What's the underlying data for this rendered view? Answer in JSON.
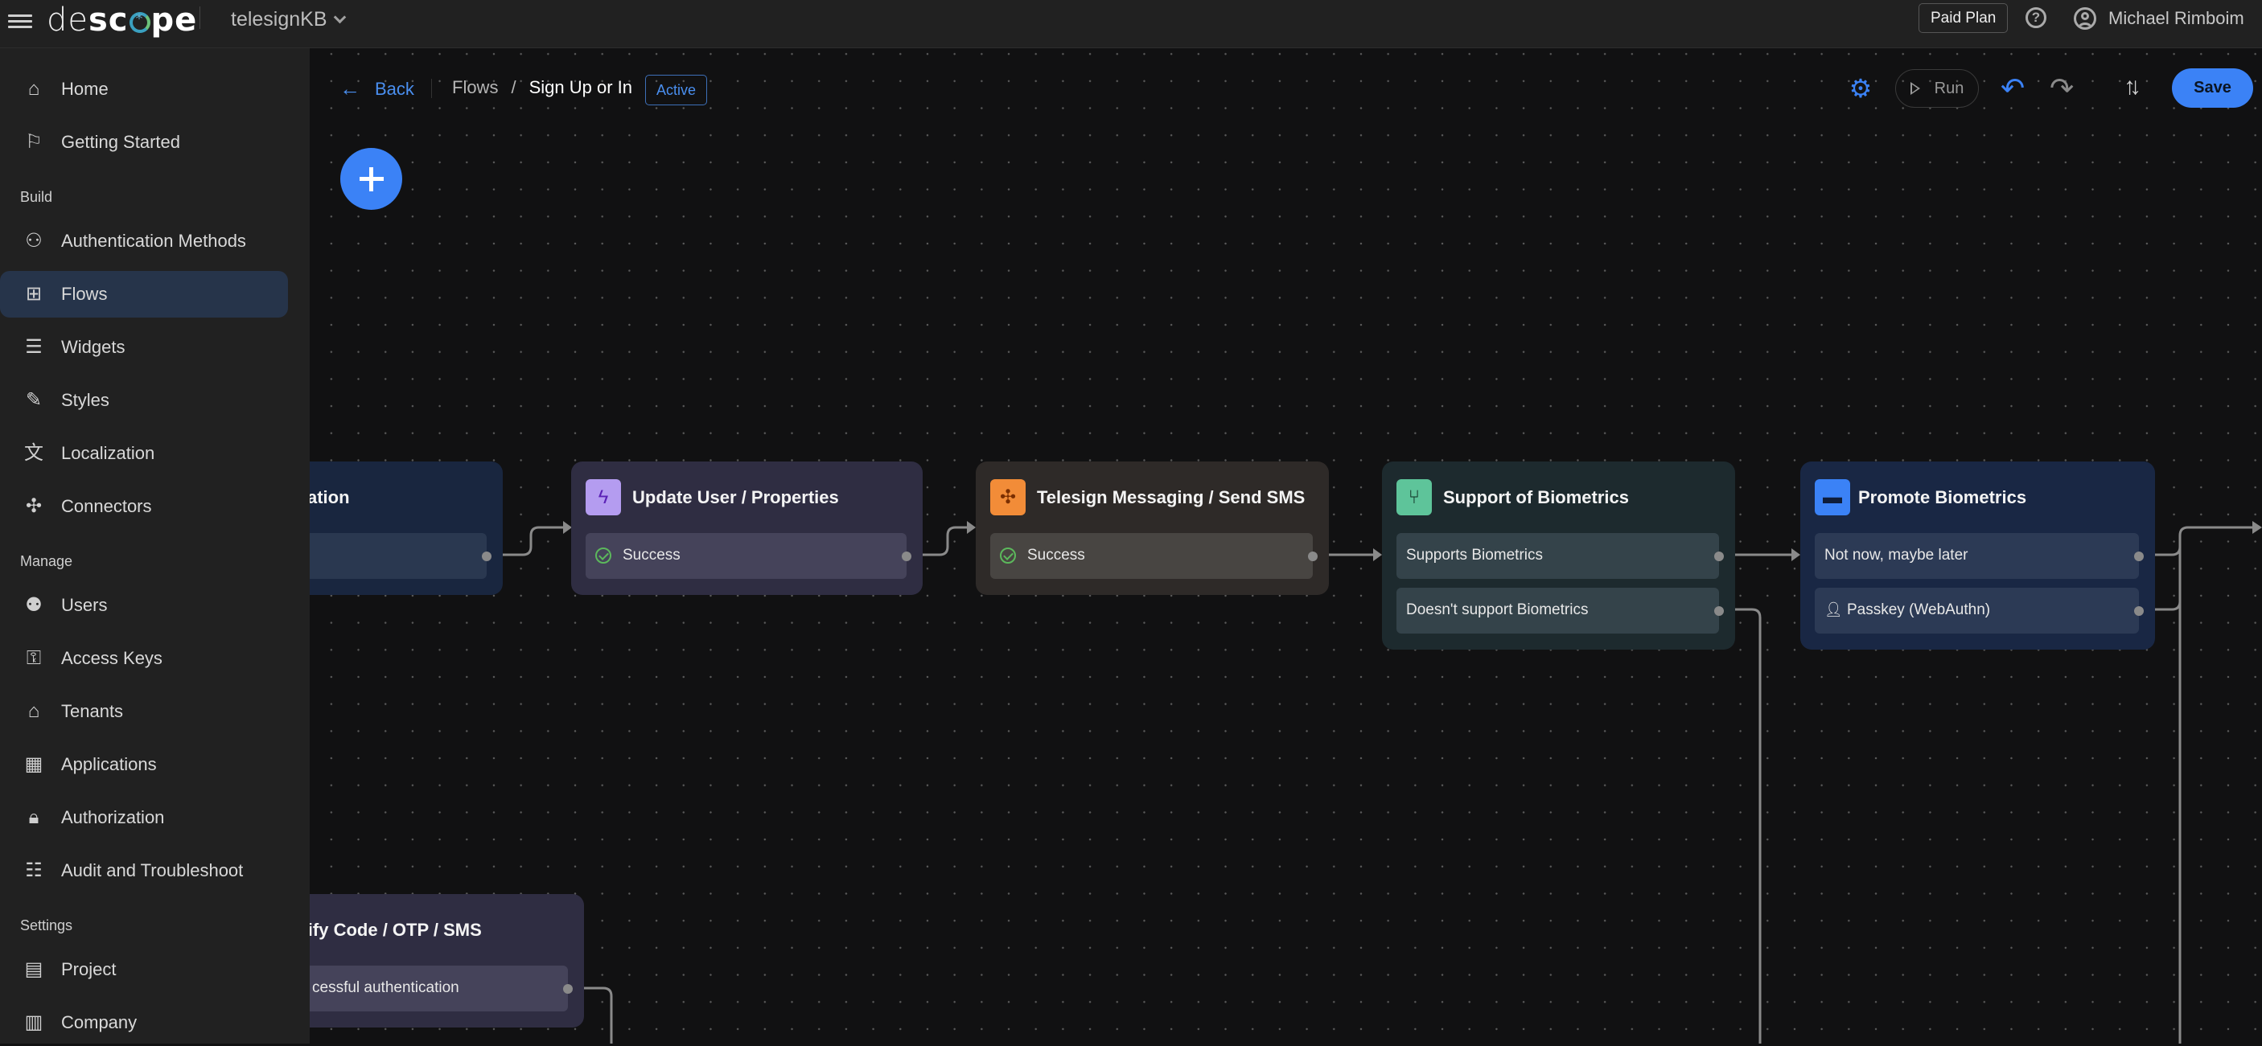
{
  "topbar": {
    "logo": {
      "part1": "de",
      "part2": "sc",
      "part3": "pe"
    },
    "project_name": "telesignKB",
    "plan_badge": "Paid Plan",
    "user_name": "Michael Rimboim"
  },
  "sidebar": {
    "items": [
      {
        "label": "Home",
        "icon": "home-icon"
      },
      {
        "label": "Getting Started",
        "icon": "flag-icon"
      },
      {
        "label": "Authentication Methods",
        "icon": "user-check-icon"
      },
      {
        "label": "Flows",
        "icon": "flow-icon",
        "active": true
      },
      {
        "label": "Widgets",
        "icon": "widget-icon"
      },
      {
        "label": "Styles",
        "icon": "brush-icon"
      },
      {
        "label": "Localization",
        "icon": "translate-icon"
      },
      {
        "label": "Connectors",
        "icon": "puzzle-icon"
      },
      {
        "label": "Users",
        "icon": "users-icon"
      },
      {
        "label": "Access Keys",
        "icon": "key-icon"
      },
      {
        "label": "Tenants",
        "icon": "tenants-icon"
      },
      {
        "label": "Applications",
        "icon": "grid-icon"
      },
      {
        "label": "Authorization",
        "icon": "lock-icon"
      },
      {
        "label": "Audit and Troubleshoot",
        "icon": "list-icon"
      },
      {
        "label": "Project",
        "icon": "folder-icon"
      },
      {
        "label": "Company",
        "icon": "building-icon"
      }
    ],
    "sections": {
      "build": "Build",
      "manage": "Manage",
      "settings": "Settings"
    }
  },
  "flow_header": {
    "back_label": "Back",
    "breadcrumb_parent": "Flows",
    "breadcrumb_separator": "/",
    "breadcrumb_current": "Sign Up or In",
    "status_badge": "Active"
  },
  "toolbar": {
    "run_label": "Run",
    "save_label": "Save",
    "accent_color": "#3b82f6"
  },
  "nodes": [
    {
      "title": "ation",
      "rows": [
        ""
      ]
    },
    {
      "title": "Update User / Properties",
      "icon": "bolt-icon",
      "rows": [
        "Success"
      ]
    },
    {
      "title": "Telesign Messaging / Send SMS",
      "icon": "connector-icon",
      "rows": [
        "Success"
      ]
    },
    {
      "title": "Support of Biometrics",
      "icon": "condition-icon",
      "rows": [
        "Supports Biometrics",
        "Doesn't support Biometrics"
      ]
    },
    {
      "title": "Promote Biometrics",
      "icon": "screen-icon",
      "rows": [
        "Not now, maybe later",
        "Passkey (WebAuthn)"
      ]
    },
    {
      "title": "erify Code / OTP / SMS",
      "rows": [
        "cessful authentication"
      ]
    }
  ]
}
